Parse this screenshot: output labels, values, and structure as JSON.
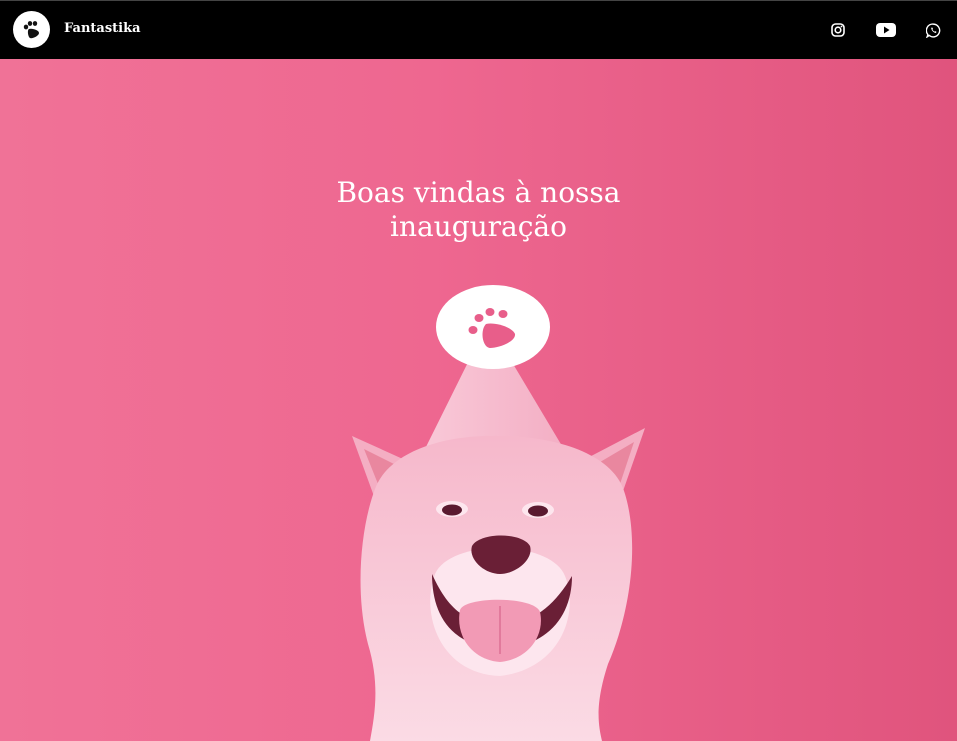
{
  "header": {
    "brand": "Fantastika",
    "logo_icon": "paw-icon",
    "social": [
      {
        "name": "instagram",
        "icon": "instagram-icon"
      },
      {
        "name": "youtube",
        "icon": "youtube-icon"
      },
      {
        "name": "whatsapp",
        "icon": "whatsapp-icon"
      }
    ]
  },
  "hero": {
    "title_line1": "Boas vindas à nossa",
    "title_line2": "inauguração",
    "image": "party-dog-illustration",
    "hat_icon": "paw-icon"
  },
  "colors": {
    "header_bg": "#000000",
    "hero_pink": "#ee6790",
    "text": "#ffffff"
  }
}
